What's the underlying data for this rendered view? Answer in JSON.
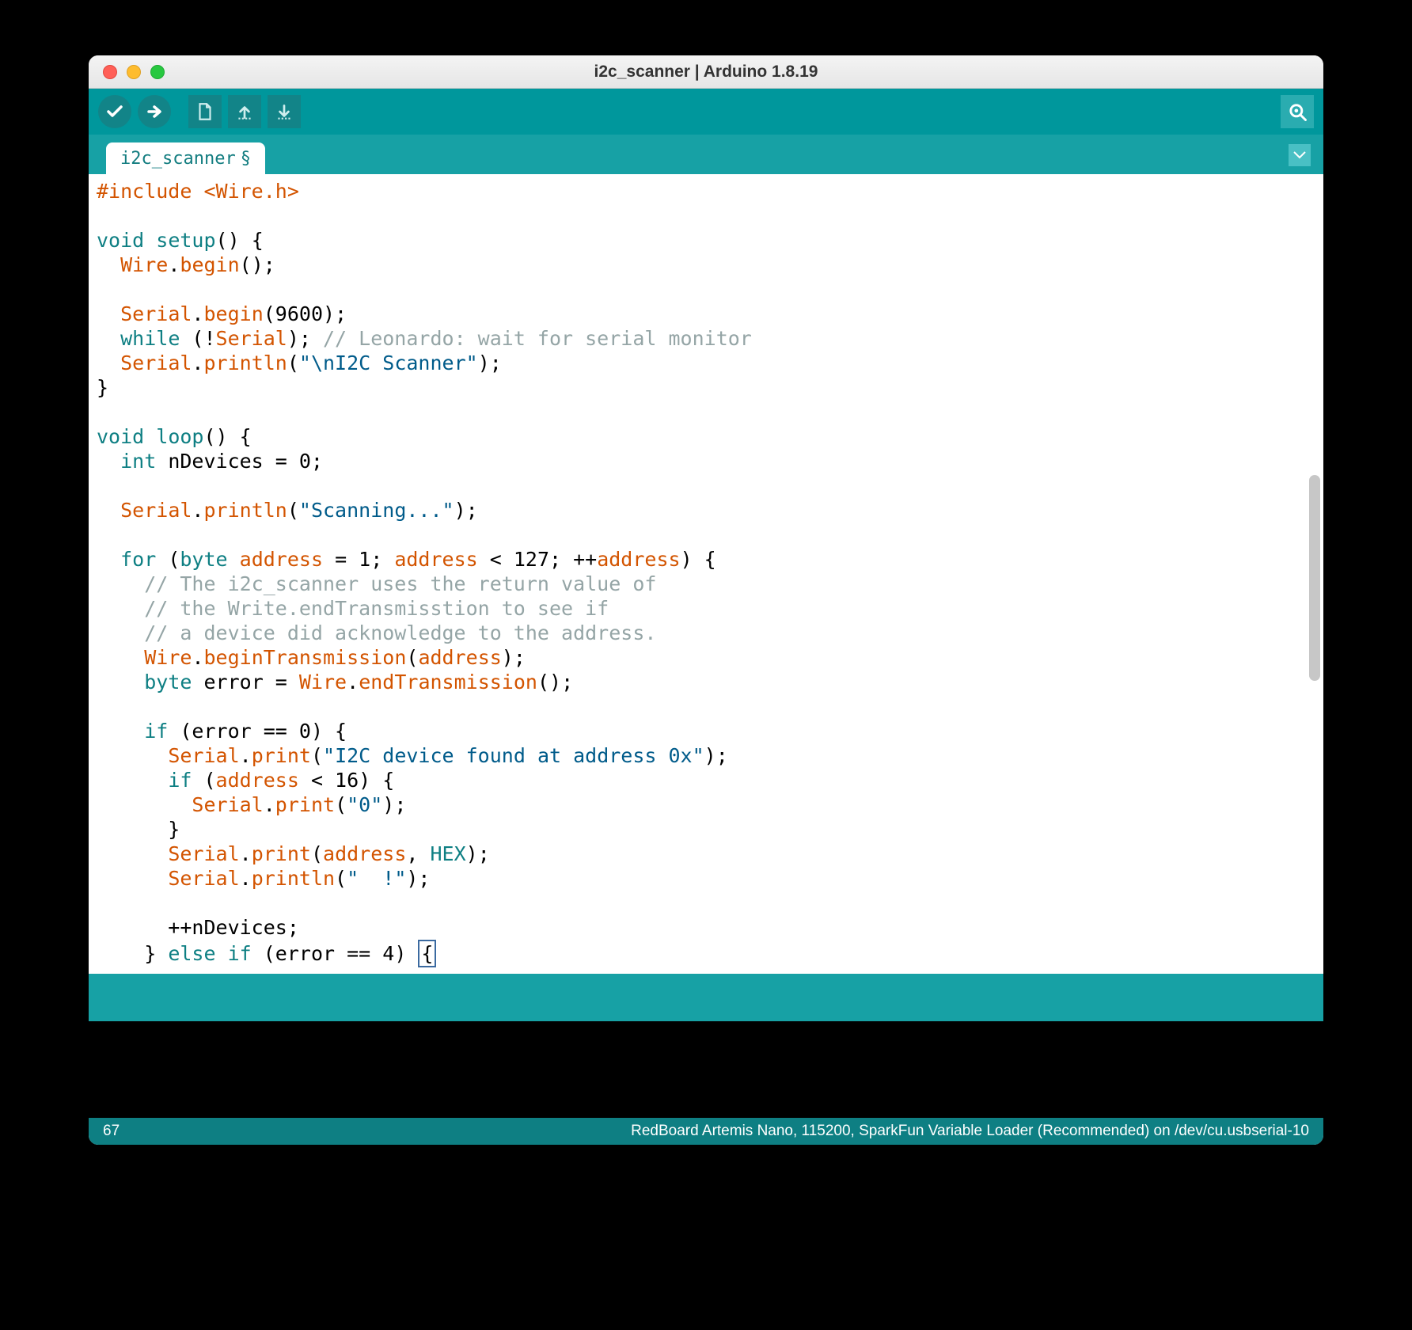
{
  "window": {
    "title": "i2c_scanner | Arduino 1.8.19"
  },
  "tabs": {
    "active": "i2c_scanner",
    "modified_marker": "§"
  },
  "status": {
    "line": "67",
    "board": "RedBoard Artemis Nano, 115200, SparkFun Variable Loader (Recommended) on /dev/cu.usbserial-10"
  },
  "code": {
    "l01a": "#include <",
    "l01b": "Wire",
    "l01c": ".h>",
    "l02": "",
    "l03a": "void",
    "l03b": " ",
    "l03c": "setup",
    "l03d": "() {",
    "l04a": "  ",
    "l04b": "Wire",
    "l04c": ".",
    "l04d": "begin",
    "l04e": "();",
    "l05": "",
    "l06a": "  ",
    "l06b": "Serial",
    "l06c": ".",
    "l06d": "begin",
    "l06e": "(9600);",
    "l07a": "  ",
    "l07b": "while",
    "l07c": " (!",
    "l07d": "Serial",
    "l07e": "); ",
    "l07f": "// Leonardo: wait for serial monitor",
    "l08a": "  ",
    "l08b": "Serial",
    "l08c": ".",
    "l08d": "println",
    "l08e": "(",
    "l08f": "\"\\nI2C Scanner\"",
    "l08g": ");",
    "l09": "}",
    "l10": "",
    "l11a": "void",
    "l11b": " ",
    "l11c": "loop",
    "l11d": "() {",
    "l12a": "  ",
    "l12b": "int",
    "l12c": " nDevices = 0;",
    "l13": "",
    "l14a": "  ",
    "l14b": "Serial",
    "l14c": ".",
    "l14d": "println",
    "l14e": "(",
    "l14f": "\"Scanning...\"",
    "l14g": ");",
    "l15": "",
    "l16a": "  ",
    "l16b": "for",
    "l16c": " (",
    "l16d": "byte",
    "l16e": " ",
    "l16f": "address",
    "l16g": " = 1; ",
    "l16h": "address",
    "l16i": " < 127; ++",
    "l16j": "address",
    "l16k": ") {",
    "l17a": "    ",
    "l17b": "// The i2c_scanner uses the return value of",
    "l18a": "    ",
    "l18b": "// the Write.endTransmisstion to see if",
    "l19a": "    ",
    "l19b": "// a device did acknowledge to the address.",
    "l20a": "    ",
    "l20b": "Wire",
    "l20c": ".",
    "l20d": "beginTransmission",
    "l20e": "(",
    "l20f": "address",
    "l20g": ");",
    "l21a": "    ",
    "l21b": "byte",
    "l21c": " error = ",
    "l21d": "Wire",
    "l21e": ".",
    "l21f": "endTransmission",
    "l21g": "();",
    "l22": "",
    "l23a": "    ",
    "l23b": "if",
    "l23c": " (error == 0) {",
    "l24a": "      ",
    "l24b": "Serial",
    "l24c": ".",
    "l24d": "print",
    "l24e": "(",
    "l24f": "\"I2C device found at address 0x\"",
    "l24g": ");",
    "l25a": "      ",
    "l25b": "if",
    "l25c": " (",
    "l25d": "address",
    "l25e": " < 16) {",
    "l26a": "        ",
    "l26b": "Serial",
    "l26c": ".",
    "l26d": "print",
    "l26e": "(",
    "l26f": "\"0\"",
    "l26g": ");",
    "l27": "      }",
    "l28a": "      ",
    "l28b": "Serial",
    "l28c": ".",
    "l28d": "print",
    "l28e": "(",
    "l28f": "address",
    "l28g": ", ",
    "l28h": "HEX",
    "l28i": ");",
    "l29a": "      ",
    "l29b": "Serial",
    "l29c": ".",
    "l29d": "println",
    "l29e": "(",
    "l29f": "\"  !\"",
    "l29g": ");",
    "l30": "",
    "l31": "      ++nDevices;",
    "l32a": "    } ",
    "l32b": "else",
    "l32c": " ",
    "l32d": "if",
    "l32e": " (error == 4) ",
    "l32f": "{"
  }
}
